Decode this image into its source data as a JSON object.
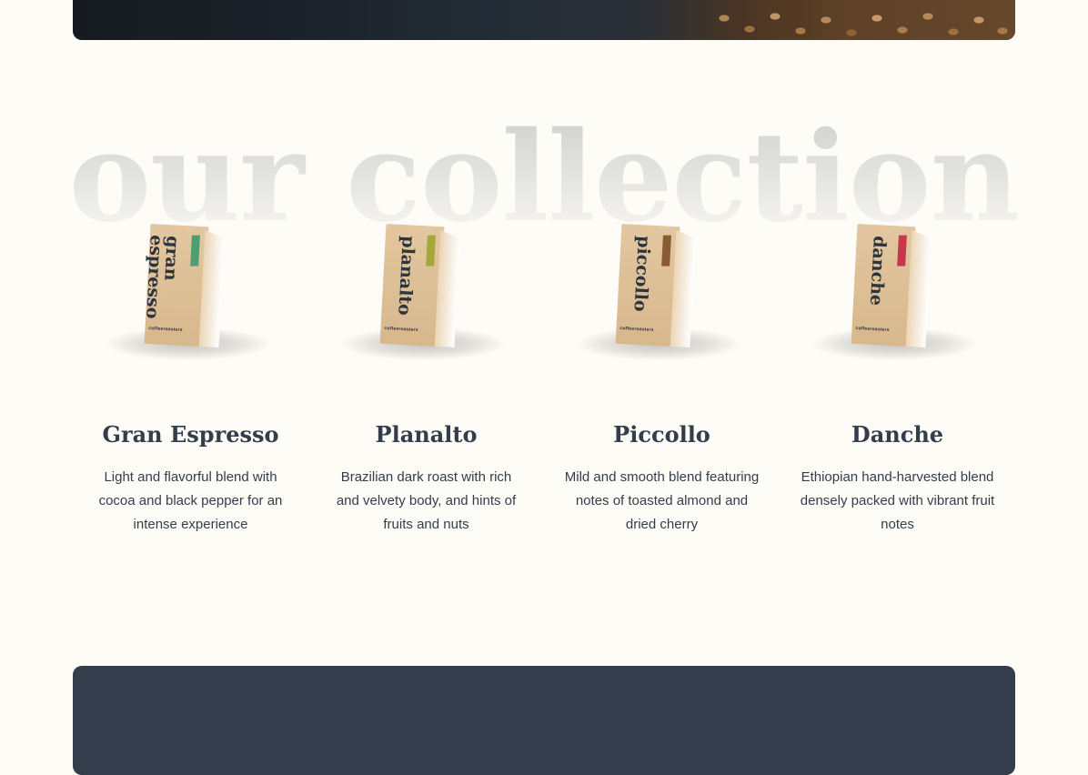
{
  "section": {
    "title": "our collection"
  },
  "brand_label": "coffeeroasters",
  "products": [
    {
      "bag_label": "gran\nespresso",
      "stripe_color": "#4F9E73",
      "name": "Gran Espresso",
      "description": "Light and flavorful blend with cocoa and black pepper for an intense experience"
    },
    {
      "bag_label": "planalto",
      "stripe_color": "#A3A83A",
      "name": "Planalto",
      "description": "Brazilian dark roast with rich and velvety body, and hints of fruits and nuts"
    },
    {
      "bag_label": "piccollo",
      "stripe_color": "#8A5A35",
      "name": "Piccollo",
      "description": "Mild and smooth blend featuring notes of toasted almond and dried cherry"
    },
    {
      "bag_label": "danche",
      "stripe_color": "#C9364E",
      "name": "Danche",
      "description": "Ethiopian hand-harvested blend densely packed with vibrant fruit notes"
    }
  ],
  "colors": {
    "background": "#FEFCF7",
    "text_dark": "#333D4B",
    "panel_dark": "#333D4B"
  }
}
